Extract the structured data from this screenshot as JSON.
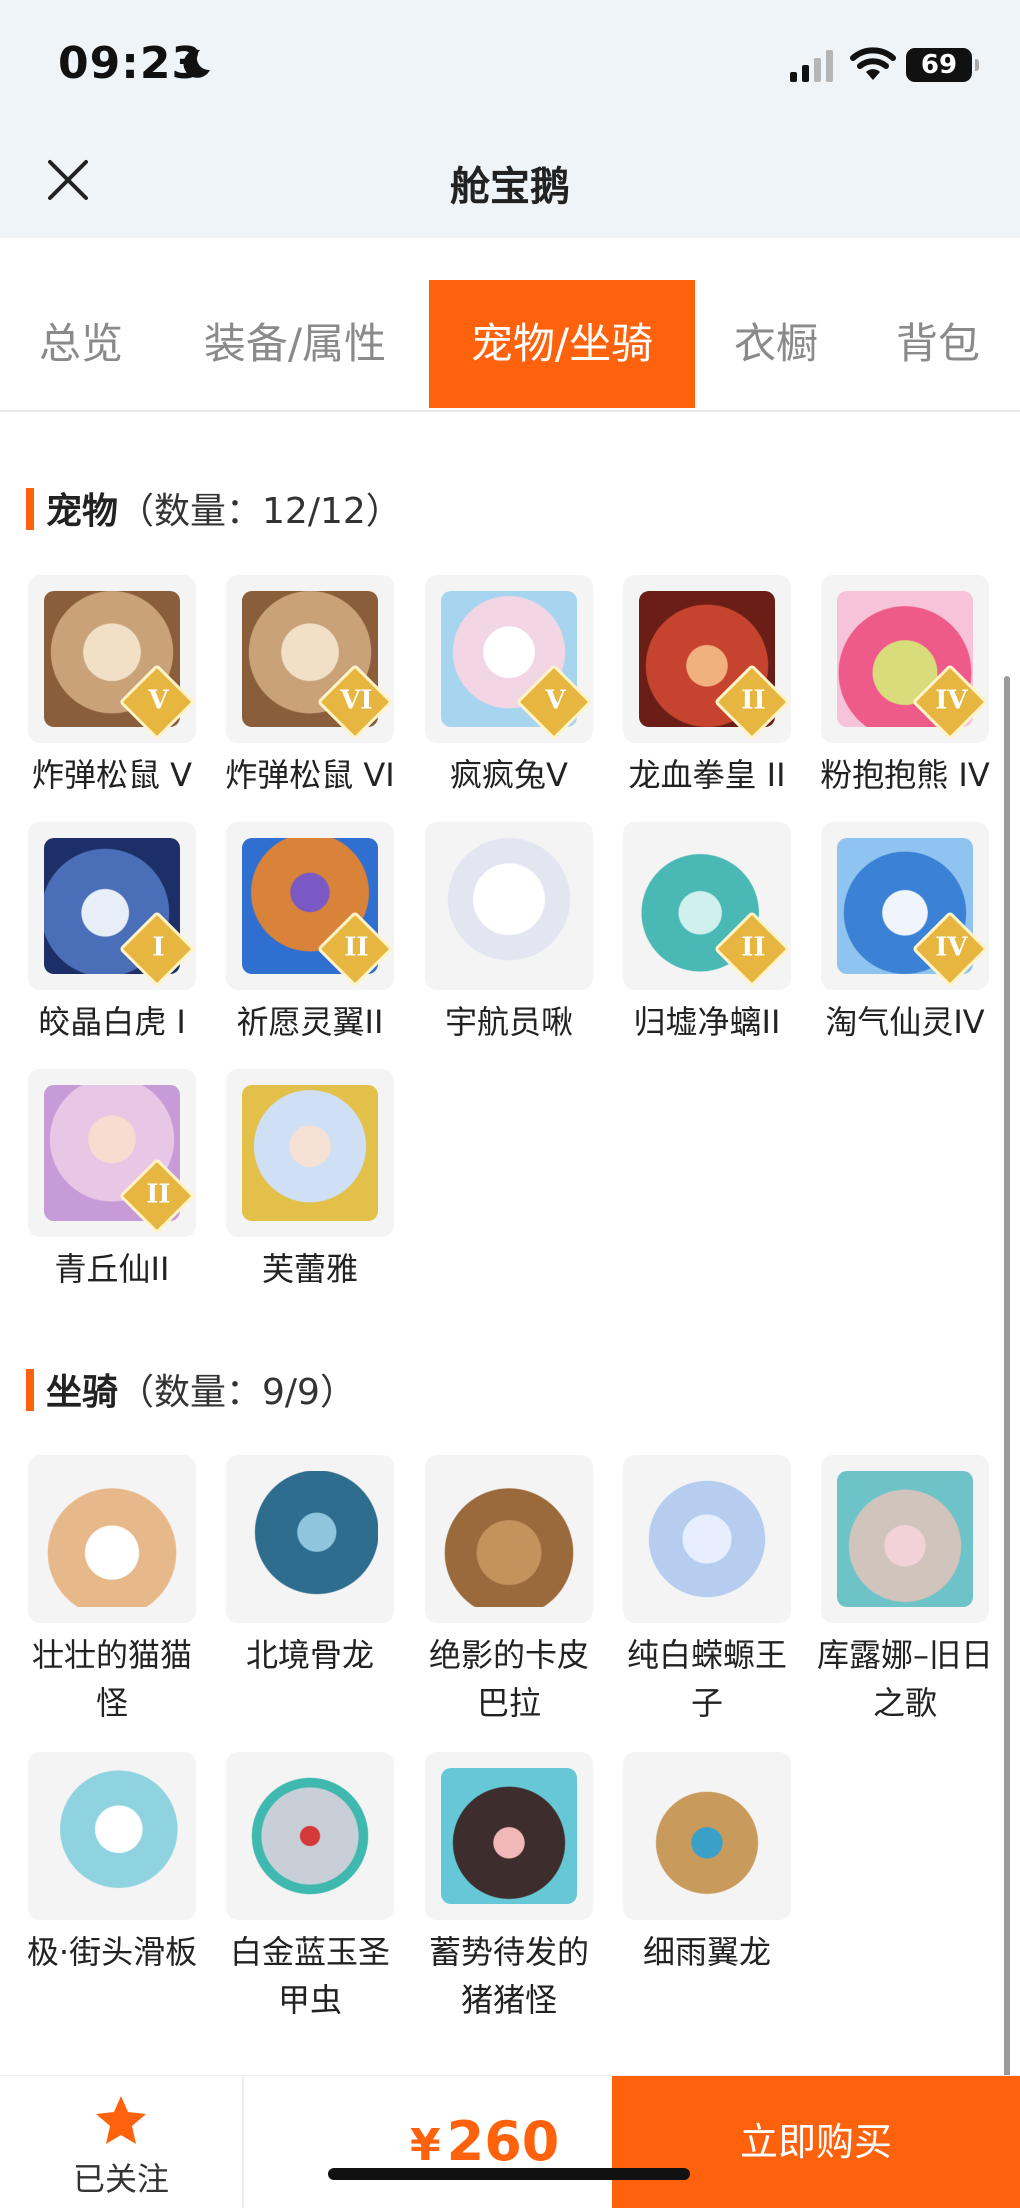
{
  "status_bar": {
    "time": "09:23",
    "battery": "69"
  },
  "header": {
    "title": "舱宝鹅"
  },
  "tabs": [
    "总览",
    "装备/属性",
    "宠物/坐骑",
    "衣橱",
    "背包"
  ],
  "active_tab": "宠物/坐骑",
  "pets": {
    "title": "宠物",
    "count": "（数量：12/12）",
    "items": [
      {
        "label": "炸弹松鼠 V",
        "tier": "V",
        "color": "#c9a27a"
      },
      {
        "label": "炸弹松鼠 VI",
        "tier": "VI",
        "color": "#c9a27a"
      },
      {
        "label": "疯疯兔V",
        "tier": "V",
        "color": "#f3d6e4"
      },
      {
        "label": "龙血拳皇 II",
        "tier": "II",
        "color": "#c6442f"
      },
      {
        "label": "粉抱抱熊 IV",
        "tier": "IV",
        "color": "#ee5a8a"
      },
      {
        "label": "皎晶白虎 I",
        "tier": "I",
        "color": "#4a6fb8"
      },
      {
        "label": "祈愿灵翼II",
        "tier": "II",
        "color": "#d9823a"
      },
      {
        "label": "宇航员啾",
        "tier": "",
        "color": "#e3e6f1"
      },
      {
        "label": "归墟净螭II",
        "tier": "II",
        "color": "#4ab9b6"
      },
      {
        "label": "淘气仙灵IV",
        "tier": "IV",
        "color": "#3b82d6"
      },
      {
        "label": "青丘仙II",
        "tier": "II",
        "color": "#e8c6e6"
      },
      {
        "label": "芙蕾雅",
        "tier": "",
        "color": "#cfe0f5"
      }
    ]
  },
  "mounts": {
    "title": "坐骑",
    "count": "（数量：9/9）",
    "items": [
      {
        "label": "壮壮的猫猫怪",
        "color": "#e7b98a"
      },
      {
        "label": "北境骨龙",
        "color": "#2f6d8f"
      },
      {
        "label": "绝影的卡皮巴拉",
        "color": "#9a6a3c"
      },
      {
        "label": "纯白蝾螈王子",
        "color": "#b6cdf0"
      },
      {
        "label": "库露娜–旧日之歌",
        "color": "#d0c4bd"
      },
      {
        "label": "极·街头滑板",
        "color": "#8ed3df"
      },
      {
        "label": "白金蓝玉圣甲虫",
        "color": "#c9cfd6"
      },
      {
        "label": "蓄势待发的猪猪怪",
        "color": "#3d2d2d"
      },
      {
        "label": "细雨翼龙",
        "color": "#c89a5c"
      }
    ]
  },
  "bottom": {
    "follow_label": "已关注",
    "currency": "¥",
    "price": "260",
    "buy_label": "立即购买"
  },
  "colors": {
    "accent": "#ff620d"
  }
}
